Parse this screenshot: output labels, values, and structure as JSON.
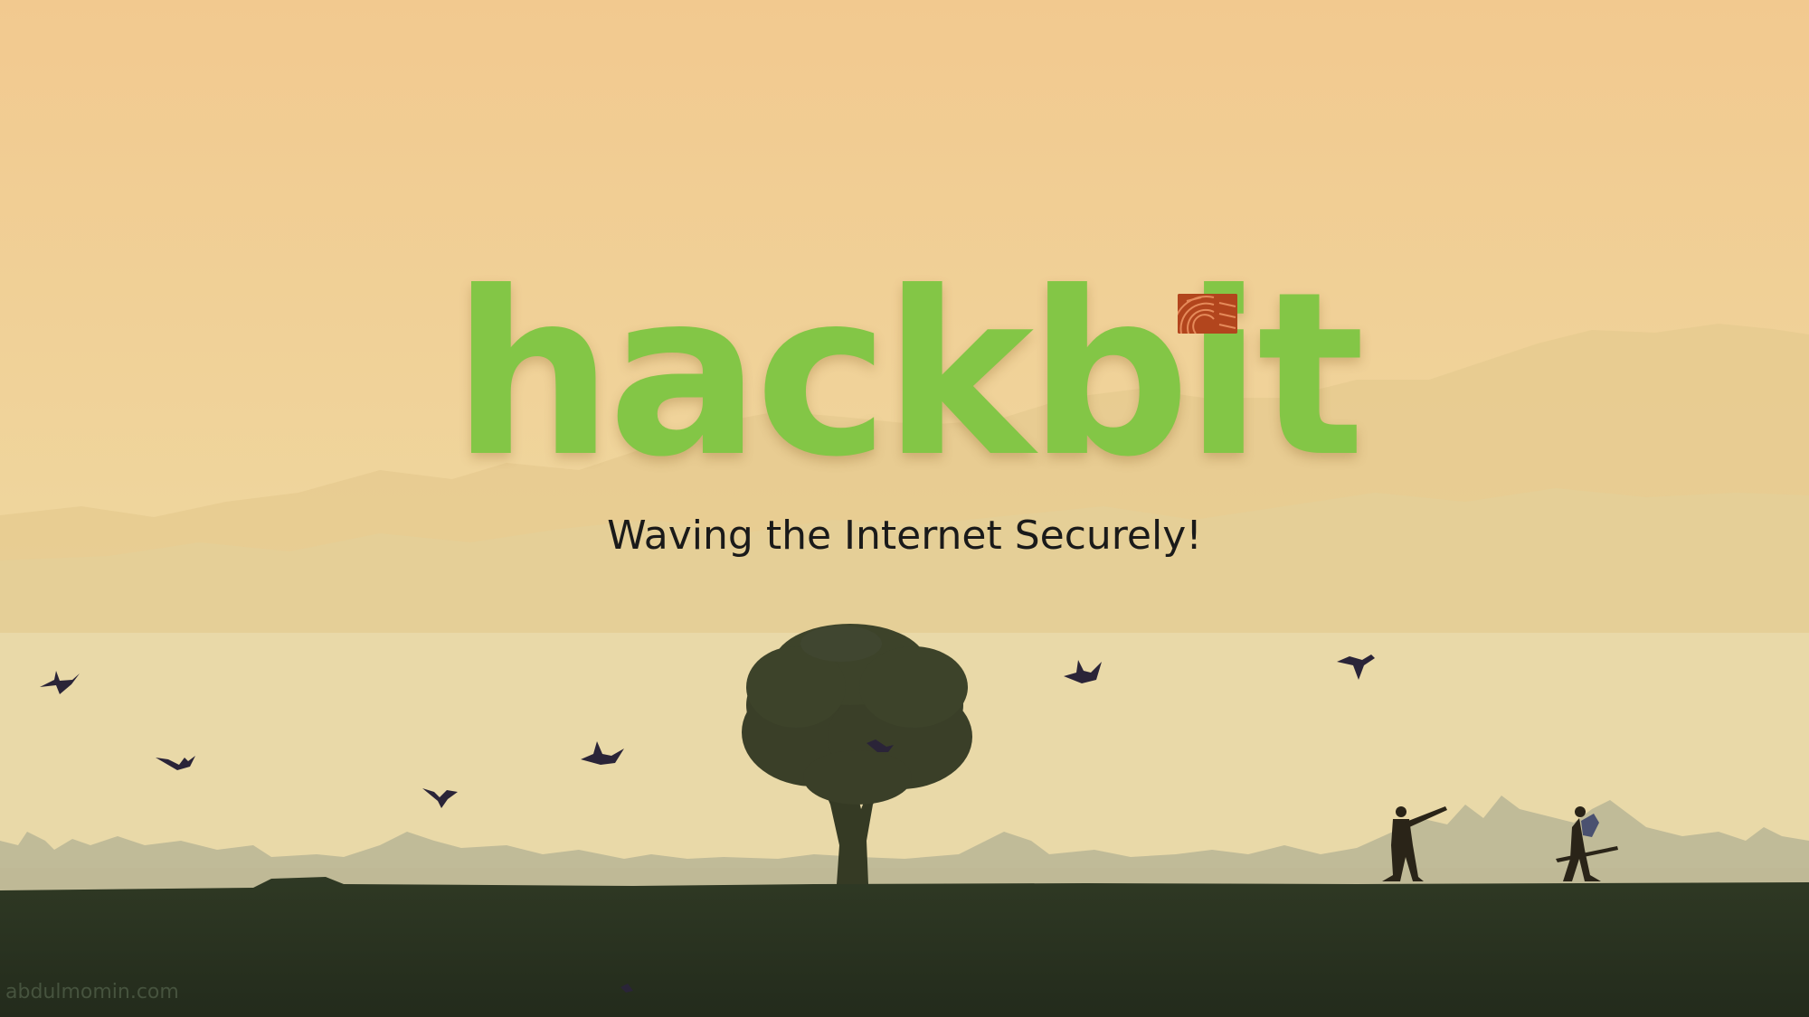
{
  "logo": {
    "text": "hackbit",
    "color": "#83c646",
    "badge_color": "#b2451d"
  },
  "tagline": "Waving the Internet Securely!",
  "watermark": "abdulmomin.com",
  "scene": {
    "sky_top_color": "#f1cc90",
    "sky_bottom_color": "#ebdba8",
    "ground_color": "#27301f",
    "icons": [
      "tree-icon",
      "bird-icon",
      "walking-person-icon",
      "mountain-silhouette"
    ]
  }
}
